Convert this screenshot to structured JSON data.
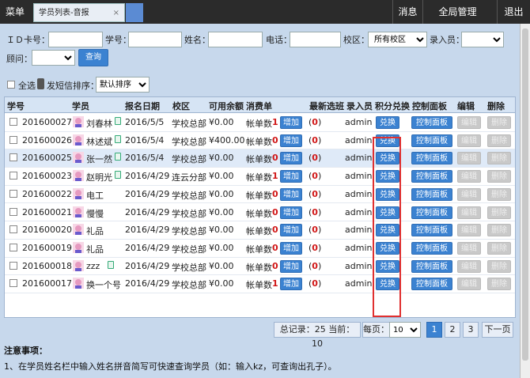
{
  "topbar": {
    "menu": "菜单",
    "tab_label": "学员列表-音报",
    "tab_close": "×",
    "right_items": [
      "消息",
      "全局管理",
      "退出"
    ]
  },
  "search": {
    "labels": [
      "ＩＤ卡号：",
      "学号：",
      "姓名：",
      "电话：",
      "校区：",
      "录入员：",
      "顾问："
    ],
    "campus_value": "所有校区",
    "query_button": "查询"
  },
  "toolbar": {
    "select_all": "全选",
    "sms_sort": "发短信排序：",
    "sort_value": "默认排序"
  },
  "table": {
    "headers": [
      "学号",
      "学员",
      "报名日期",
      "校区",
      "可用余额",
      "消费单",
      "最新选班",
      "录入员",
      "积分兑换",
      "控制面板",
      "编辑",
      "删除"
    ],
    "bill_label": "帐单数",
    "add_label": "增加",
    "exchange_label": "兑换",
    "panel_label": "控制面板",
    "edit_label": "编辑",
    "delete_label": "删除",
    "rows": [
      {
        "id": "201600027",
        "name": "刘春林",
        "date": "2016/5/5",
        "campus": "学校总部",
        "balance": "¥0.00",
        "bills": "1",
        "latest": "(0)",
        "recorder": "admin",
        "memo": true
      },
      {
        "id": "201600026",
        "name": "林述斌",
        "date": "2016/5/4",
        "campus": "学校总部",
        "balance": "¥400.00",
        "bills": "0",
        "latest": "(0)",
        "recorder": "admin",
        "memo": true
      },
      {
        "id": "201600025",
        "name": "张一然",
        "date": "2016/5/4",
        "campus": "学校总部",
        "balance": "¥0.00",
        "bills": "0",
        "latest": "(0)",
        "recorder": "admin",
        "memo": true
      },
      {
        "id": "201600023",
        "name": "赵明光",
        "date": "2016/4/29",
        "campus": "连云分部",
        "balance": "¥0.00",
        "bills": "1",
        "latest": "(0)",
        "recorder": "admin",
        "memo": true
      },
      {
        "id": "201600022",
        "name": "电工",
        "date": "2016/4/29",
        "campus": "学校总部",
        "balance": "¥0.00",
        "bills": "0",
        "latest": "(0)",
        "recorder": "admin",
        "memo": false
      },
      {
        "id": "201600021",
        "name": "慢慢",
        "date": "2016/4/29",
        "campus": "学校总部",
        "balance": "¥0.00",
        "bills": "0",
        "latest": "(0)",
        "recorder": "admin",
        "memo": false
      },
      {
        "id": "201600020",
        "name": "礼品",
        "date": "2016/4/29",
        "campus": "学校总部",
        "balance": "¥0.00",
        "bills": "0",
        "latest": "(0)",
        "recorder": "admin",
        "memo": false
      },
      {
        "id": "201600019",
        "name": "礼品",
        "date": "2016/4/29",
        "campus": "学校总部",
        "balance": "¥0.00",
        "bills": "0",
        "latest": "(0)",
        "recorder": "admin",
        "memo": false
      },
      {
        "id": "201600018",
        "name": "zzz",
        "date": "2016/4/29",
        "campus": "学校总部",
        "balance": "¥0.00",
        "bills": "0",
        "latest": "(0)",
        "recorder": "admin",
        "memo": true
      },
      {
        "id": "201600017",
        "name": "换一个号",
        "date": "2016/4/29",
        "campus": "学校总部",
        "balance": "¥0.00",
        "bills": "1",
        "latest": "(0)",
        "recorder": "admin",
        "memo": false
      }
    ]
  },
  "pager": {
    "summary": "总记录：25 当前：10",
    "per_page_label": "每页：",
    "per_page_value": "10",
    "pages": [
      "1",
      "2",
      "3"
    ],
    "next": "下一页"
  },
  "notes": {
    "title": "注意事项：",
    "items": [
      "1、在学员姓名栏中输入姓名拼音简写可快速查询学员（如：输入kz，可查询出孔子）。"
    ]
  }
}
